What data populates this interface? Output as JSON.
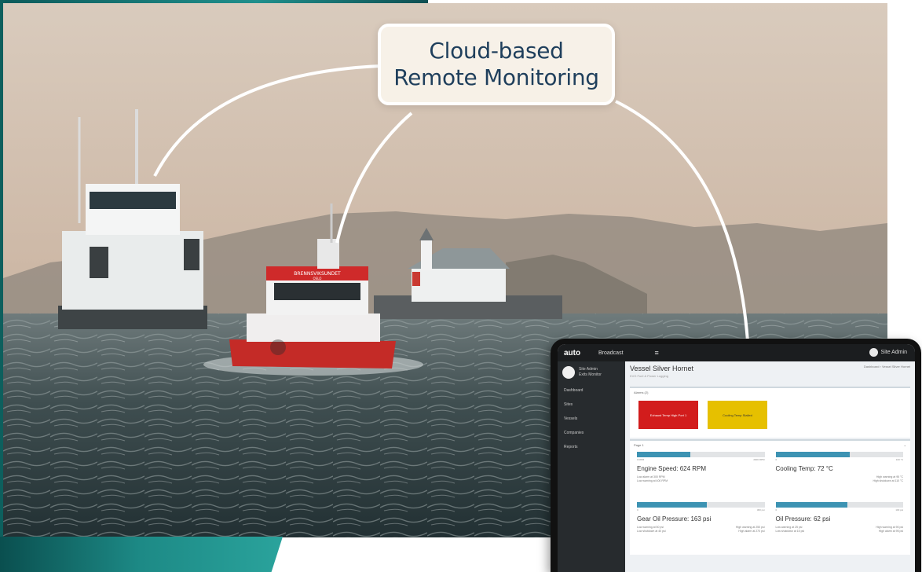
{
  "callout": {
    "line1": "Cloud-based",
    "line2": "Remote Monitoring"
  },
  "ship": {
    "bow_sign": "BRENNSVIKSUNDET",
    "bow_sign_sub": "OSLO"
  },
  "tablet": {
    "logo": "auto",
    "brand": "Broadcast",
    "menu_icon": "≡",
    "user": "Site Admin",
    "sidebar": {
      "user_name": "Site Admin",
      "user_role": "Exits Monitor",
      "items": [
        "Dashboard",
        "Sites",
        "Vessels",
        "Companies",
        "Reports"
      ]
    },
    "header": {
      "title": "Vessel Silver Hornet",
      "subtitle": "KVG Fuel & Power Logging",
      "breadcrumb": "Dashboard › Vessel Silver Hornet"
    },
    "alarms_label": "Alarms (2)",
    "alarms": [
      {
        "text": "Exhaust Temp High Port 1",
        "color": "#d21c1c"
      },
      {
        "text": "Cooling Temp Stalled",
        "color": "#e6c000"
      }
    ],
    "page_label": "Page 1",
    "gauges": [
      {
        "title": "Engine Speed: 624 RPM",
        "fill": 0.42,
        "min": "0 RPM",
        "max": "2000 RPM",
        "left_notes": [
          "Low alarm at 300 RPM",
          "Low warning at 400 RPM"
        ],
        "right_notes": []
      },
      {
        "title": "Cooling Temp: 72 °C",
        "fill": 0.58,
        "min": "0",
        "max": "100 °C",
        "left_notes": [],
        "right_notes": [
          "High warning at 95 °C",
          "High shutdown at 110 °C"
        ]
      },
      {
        "title": "Gear Oil Pressure: 163 psi",
        "fill": 0.55,
        "min": "0",
        "max": "300 psi",
        "left_notes": [
          "Low warning at 50 psi",
          "Low shutdown at 40 psi"
        ],
        "right_notes": [
          "High warning at 250 psi",
          "High alarm at 270 psi"
        ]
      },
      {
        "title": "Oil Pressure: 62 psi",
        "fill": 0.56,
        "min": "0",
        "max": "100 psi",
        "left_notes": [
          "Low warning at 25 psi",
          "Low shutdown at 15 psi"
        ],
        "right_notes": [
          "High warning at 90 psi",
          "High alarm at 95 psi"
        ]
      }
    ]
  }
}
